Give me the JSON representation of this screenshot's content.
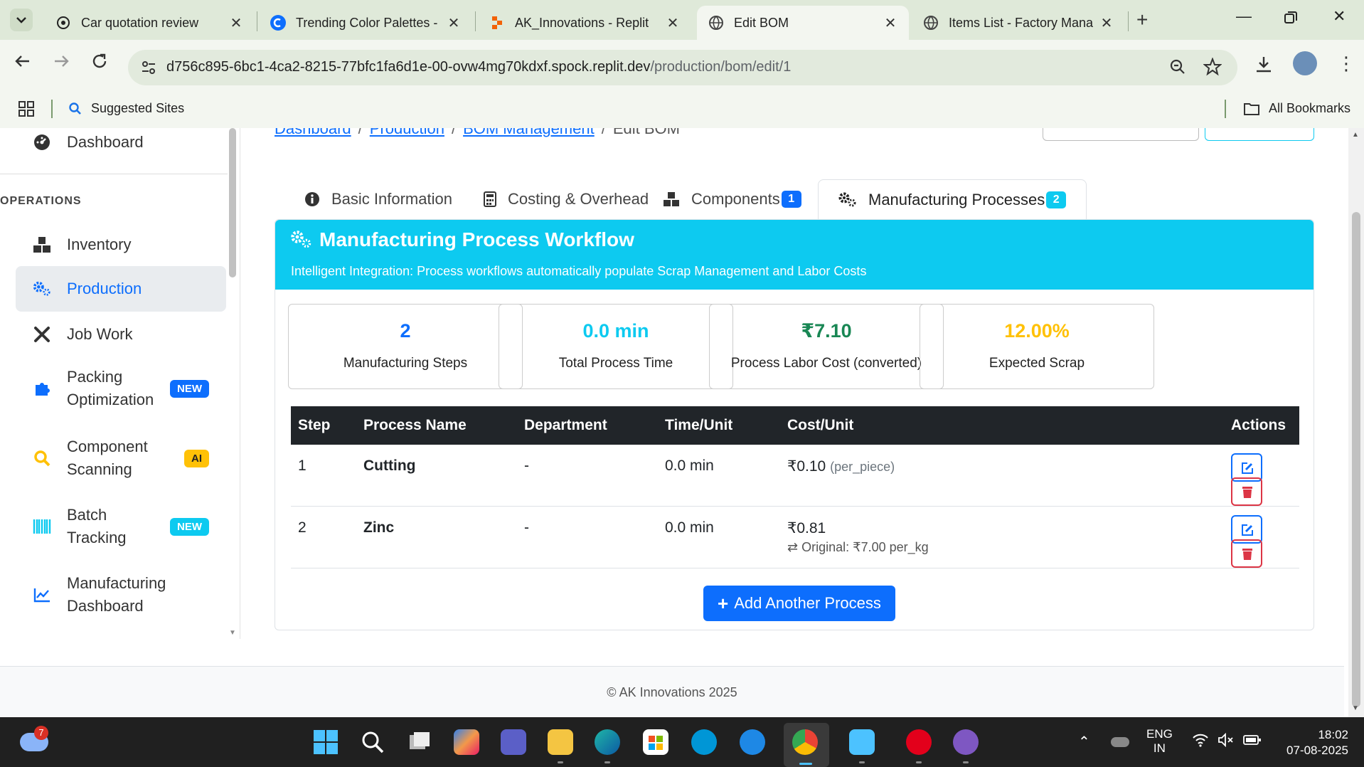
{
  "browser": {
    "tabs": [
      {
        "label": "Car quotation review",
        "favicon": "openai-icon"
      },
      {
        "label": "Trending Color Palettes -",
        "favicon": "coolors-icon"
      },
      {
        "label": "AK_Innovations - Replit",
        "favicon": "replit-icon"
      },
      {
        "label": "Edit BOM",
        "favicon": "globe-icon",
        "active": true
      },
      {
        "label": "Items List - Factory Mana",
        "favicon": "globe-icon"
      }
    ],
    "url_host": "d756c895-6bc1-4ca2-8215-77bfc1fa6d1e-00-ovw4mg70kdxf.spock.replit.dev",
    "url_path": "/production/bom/edit/1",
    "bookmarks": {
      "suggested": "Suggested Sites",
      "all": "All Bookmarks"
    }
  },
  "sidebar": {
    "dashboard": "Dashboard",
    "section": "OPERATIONS",
    "items": [
      {
        "label": "Inventory",
        "icon": "boxes-icon"
      },
      {
        "label": "Production",
        "icon": "gears-icon",
        "active": true
      },
      {
        "label": "Job Work",
        "icon": "tools-icon"
      },
      {
        "label": "Packing Optimization",
        "icon": "puzzle-icon",
        "badge": "NEW"
      },
      {
        "label": "Component Scanning",
        "icon": "search-icon",
        "badge": "AI"
      },
      {
        "label": "Batch Tracking",
        "icon": "barcode-icon",
        "badge": "NEW"
      },
      {
        "label": "Manufacturing Dashboard",
        "icon": "chart-line-icon"
      }
    ]
  },
  "breadcrumb": {
    "b1": "Dashboard",
    "b2": "Production",
    "b3": "BOM Management",
    "current": "Edit BOM"
  },
  "tabs": {
    "basic": "Basic Information",
    "costing": "Costing & Overhead",
    "components": "Components",
    "components_count": "1",
    "processes": "Manufacturing Processes",
    "processes_count": "2"
  },
  "workflow": {
    "title": "Manufacturing Process Workflow",
    "subtitle": "Intelligent Integration: Process workflows automatically populate Scrap Management and Labor Costs"
  },
  "stats": [
    {
      "value": "2",
      "label": "Manufacturing Steps",
      "color": "#0d6efd"
    },
    {
      "value": "0.0 min",
      "label": "Total Process Time",
      "color": "#0dcaf0"
    },
    {
      "value": "₹7.10",
      "label": "Process Labor Cost (converted)",
      "color": "#198754"
    },
    {
      "value": "12.00%",
      "label": "Expected Scrap",
      "color": "#ffc107"
    }
  ],
  "table": {
    "headers": {
      "step": "Step",
      "name": "Process Name",
      "dept": "Department",
      "time": "Time/Unit",
      "cost": "Cost/Unit",
      "actions": "Actions"
    },
    "rows": [
      {
        "step": "1",
        "name": "Cutting",
        "dept": "-",
        "time": "0.0 min",
        "cost": "₹0.10",
        "cost_note": "(per_piece)"
      },
      {
        "step": "2",
        "name": "Zinc",
        "dept": "-",
        "time": "0.0 min",
        "cost": "₹0.81",
        "original": "Original: ₹7.00 per_kg"
      }
    ]
  },
  "add_button": "Add Another Process",
  "footer": "© AK Innovations 2025",
  "taskbar": {
    "weather_badge": "7",
    "lang1": "ENG",
    "lang2": "IN",
    "time": "18:02",
    "date": "07-08-2025"
  }
}
